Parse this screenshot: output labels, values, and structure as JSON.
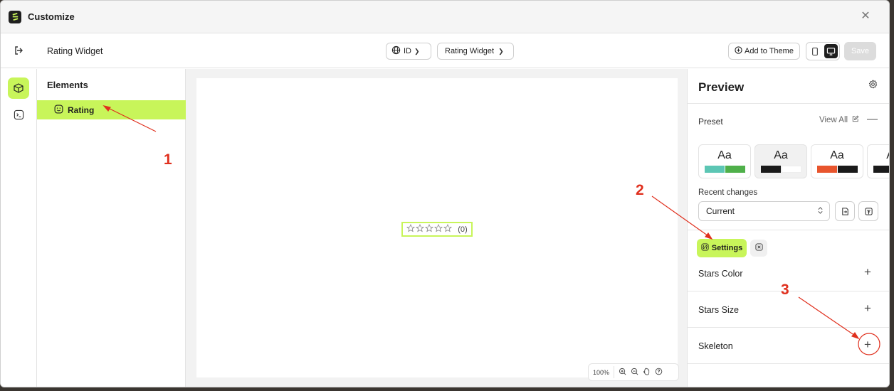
{
  "window": {
    "title": "Customize"
  },
  "header": {
    "page_name": "Rating Widget",
    "language": "ID",
    "page_select": "Rating Widget",
    "add_to_theme": "Add to Theme",
    "save_label": "Save"
  },
  "elements_panel": {
    "title": "Elements",
    "items": [
      {
        "label": "Rating"
      }
    ]
  },
  "canvas": {
    "rating_count": "(0)",
    "zoom": "100%"
  },
  "right_panel": {
    "title": "Preview",
    "preset_label": "Preset",
    "view_all": "View All",
    "presets": [
      {
        "label": "Aa",
        "colors": [
          "#5cc6b4",
          "#4fb04a"
        ]
      },
      {
        "label": "Aa",
        "colors": [
          "#1a1a1a",
          "#ffffff"
        ]
      },
      {
        "label": "Aa",
        "colors": [
          "#e8552d",
          "#1a1a1a"
        ]
      },
      {
        "label": "Aa",
        "colors": [
          "#1a1a1a"
        ]
      }
    ],
    "recent_changes_label": "Recent changes",
    "recent_changes_value": "Current",
    "tabs": {
      "settings": "Settings"
    },
    "sections": [
      {
        "label": "Stars Color"
      },
      {
        "label": "Stars Size"
      },
      {
        "label": "Skeleton"
      }
    ]
  },
  "annotations": [
    "1",
    "2",
    "3"
  ],
  "colors": {
    "accent": "#c8f55a",
    "annotation": "#e0301e"
  }
}
